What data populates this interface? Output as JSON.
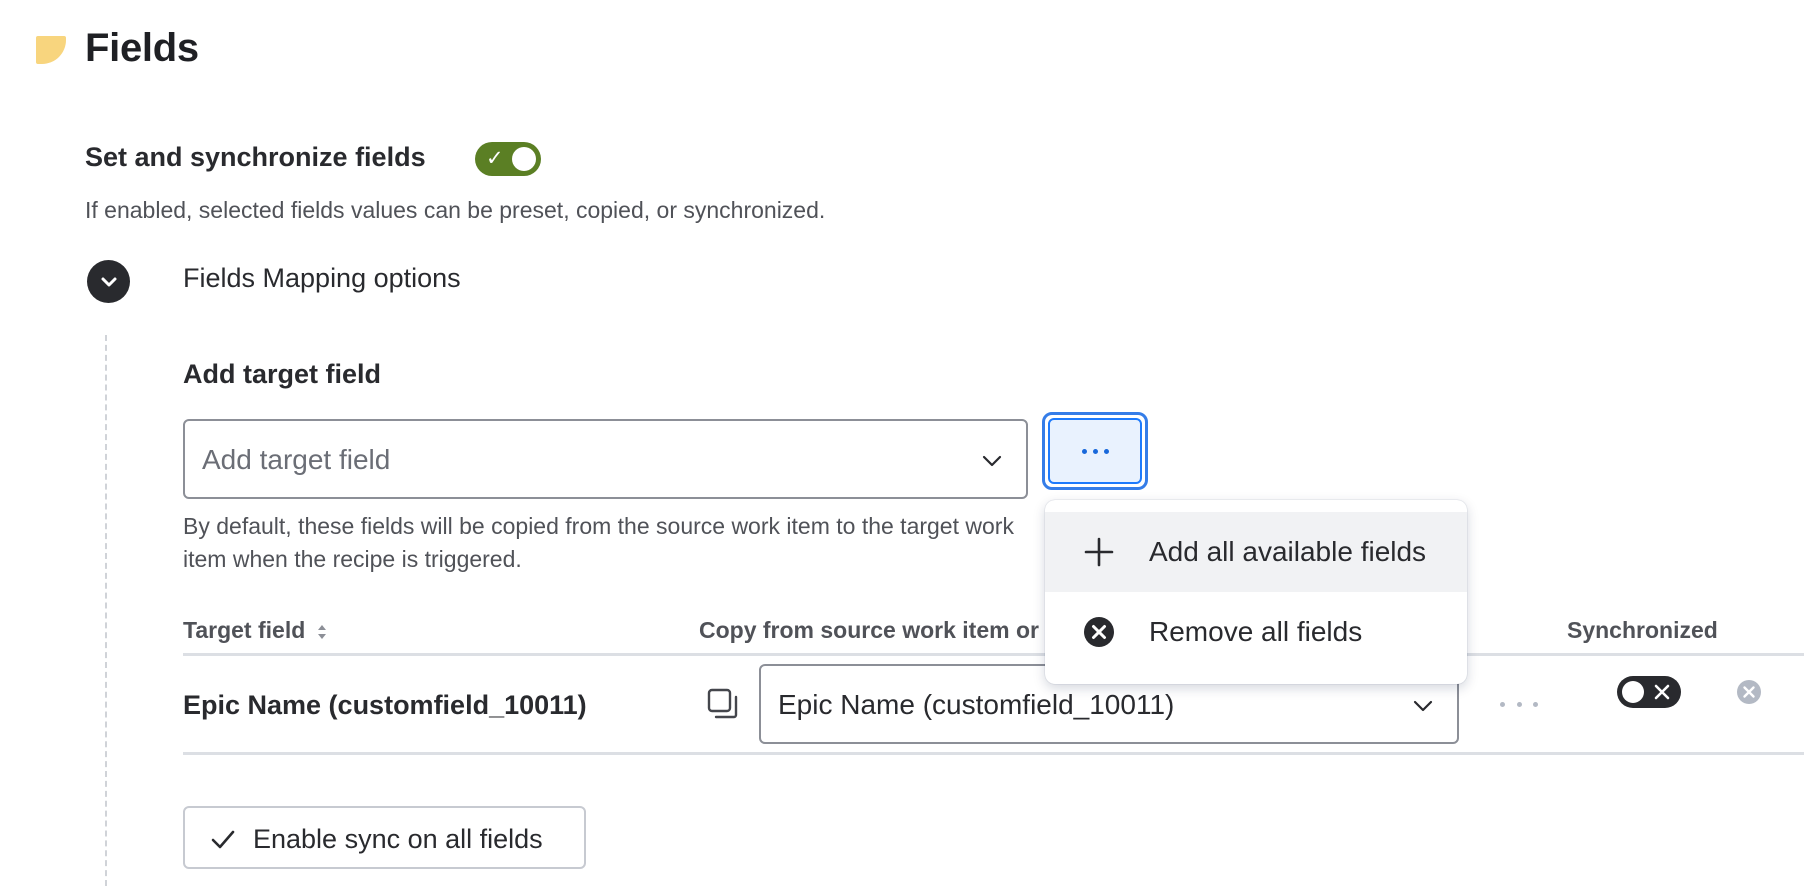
{
  "header": {
    "title": "Fields"
  },
  "sync": {
    "label": "Set and synchronize fields",
    "enabled": true,
    "help": "If enabled, selected fields values can be preset, copied, or synchronized."
  },
  "mapping": {
    "title": "Fields Mapping options",
    "add_target": {
      "label": "Add target field",
      "placeholder": "Add target field"
    },
    "help_line1": "By default, these fields will be copied from the source work item to the target work",
    "help_line2": "item when the recipe is triggered."
  },
  "table": {
    "columns": {
      "target": "Target field",
      "copy": "Copy from source work item or set value",
      "sync": "Synchronized"
    },
    "rows": [
      {
        "target": "Epic Name (customfield_10011)",
        "source": "Epic Name (customfield_10011)",
        "synchronized": false
      }
    ]
  },
  "enable_all": {
    "label": "Enable sync on all fields"
  },
  "menu": {
    "items": [
      {
        "label": "Add all available fields",
        "icon": "plus-icon"
      },
      {
        "label": "Remove all fields",
        "icon": "cross-circle-icon"
      }
    ]
  },
  "colors": {
    "toggle_on": "#5b7f24",
    "focus": "#357de8",
    "section_icon": "#f8d57e"
  }
}
